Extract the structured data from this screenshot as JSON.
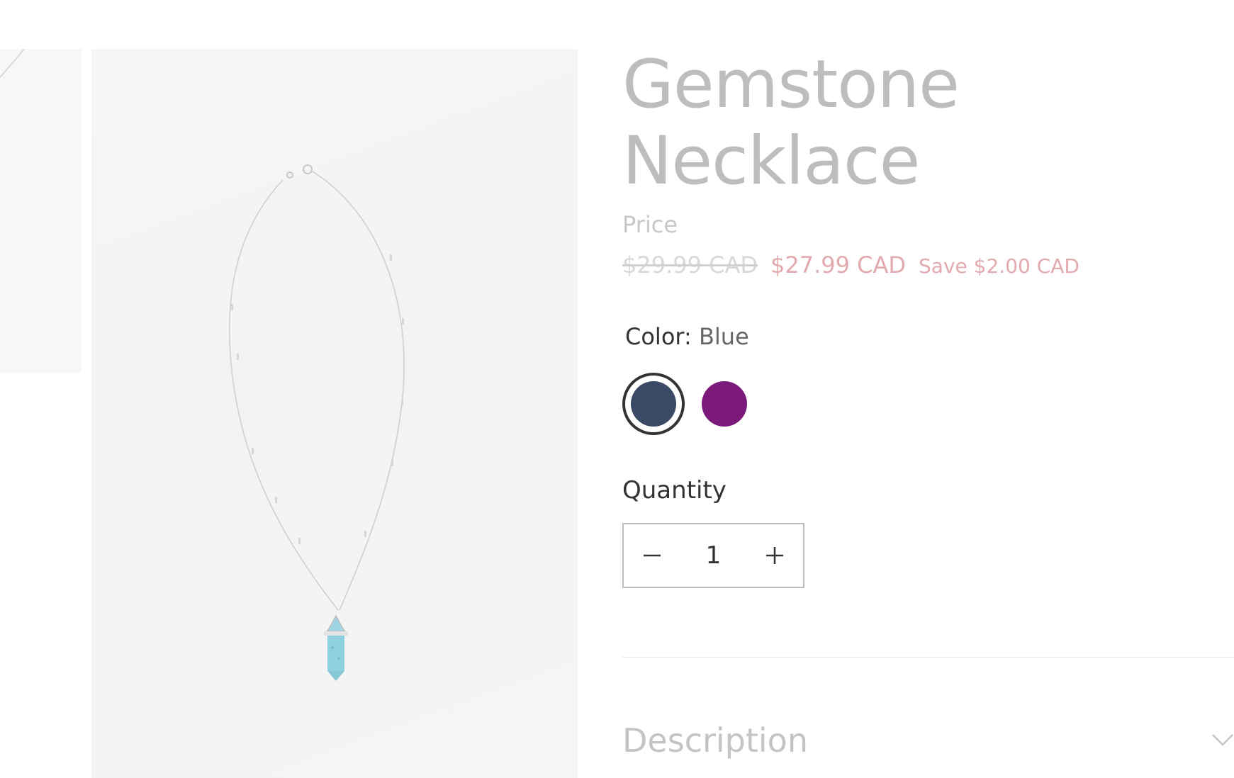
{
  "product": {
    "title": "Gemstone Necklace",
    "price_label": "Price",
    "original_price": "$29.99 CAD",
    "sale_price": "$27.99 CAD",
    "savings": "Save $2.00 CAD"
  },
  "color": {
    "label": "Color:",
    "selected": "Blue",
    "swatches": [
      {
        "name": "Blue",
        "hex": "#3a4a66",
        "selected": true
      },
      {
        "name": "Purple",
        "hex": "#7b1a7a",
        "selected": false
      }
    ]
  },
  "quantity": {
    "label": "Quantity",
    "value": "1",
    "minus_icon": "minus-icon",
    "plus_icon": "plus-icon"
  },
  "accordion": {
    "description_label": "Description",
    "icon": "chevron-down-icon"
  },
  "colors": {
    "title": "#bdbdbd",
    "sale": "#e2aaae",
    "gem": "#8ecfe0"
  }
}
